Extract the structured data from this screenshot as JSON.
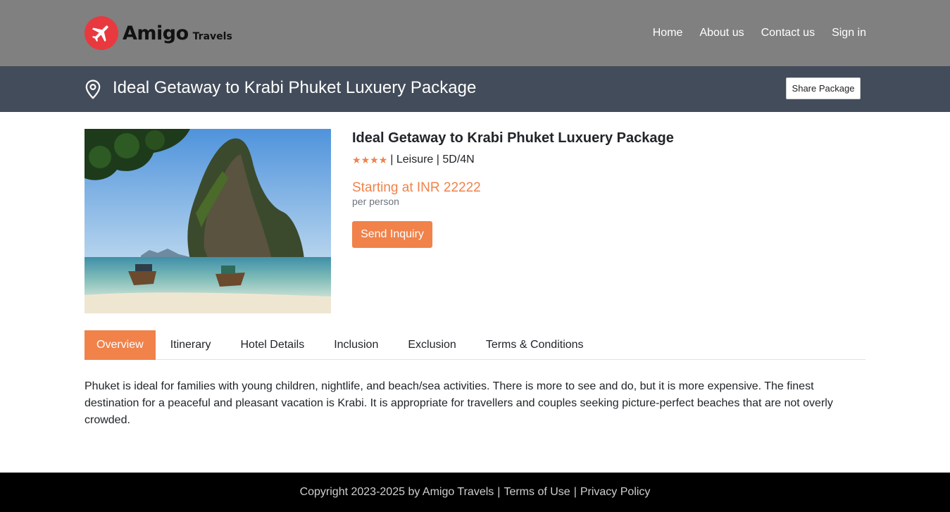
{
  "brand": {
    "name": "Amigo",
    "sub": "Travels",
    "logo_icon": "airplane-icon",
    "logo_color": "#e8393f"
  },
  "nav": {
    "home": "Home",
    "about": "About us",
    "contact": "Contact us",
    "signin": "Sign in"
  },
  "titlebar": {
    "icon": "location-pin-icon",
    "title": "Ideal Getaway to Krabi Phuket Luxuery Package",
    "share_label": "Share Package",
    "bg_color": "#434c5a"
  },
  "package": {
    "image": "krabi-beach-longtail-boats",
    "title": "Ideal Getaway to Krabi Phuket Luxuery Package",
    "rating": 4,
    "meta": "| Leisure | 5D/4N",
    "price": "Starting at INR 22222",
    "per": "per person",
    "inquiry_label": "Send Inquiry",
    "accent_color": "#f0824a"
  },
  "tabs": {
    "overview": "Overview",
    "itinerary": "Itinerary",
    "hotel": "Hotel Details",
    "inclusion": "Inclusion",
    "exclusion": "Exclusion",
    "terms": "Terms & Conditions",
    "active": "Overview"
  },
  "overview_text": "Phuket is ideal for families with young children, nightlife, and beach/sea activities. There is more to see and do, but it is more expensive. The finest destination for a peaceful and pleasant vacation is Krabi. It is appropriate for travellers and couples seeking picture-perfect beaches that are not overly crowded.",
  "footer": {
    "copyright": "Copyright 2023-2025 by Amigo Travels",
    "terms": "Terms of Use",
    "privacy": "Privacy Policy",
    "sep": "|"
  }
}
